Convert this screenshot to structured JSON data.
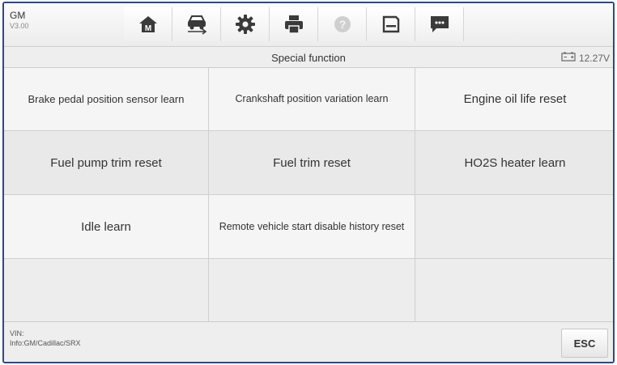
{
  "app": {
    "brand": "GM",
    "version": "V3.00"
  },
  "toolbar": [
    {
      "icon": "home-icon"
    },
    {
      "icon": "vehicle-swap-icon"
    },
    {
      "icon": "settings-gear-icon"
    },
    {
      "icon": "printer-icon"
    },
    {
      "icon": "help-icon"
    },
    {
      "icon": "save-icon"
    },
    {
      "icon": "message-icon"
    }
  ],
  "header": {
    "title": "Special function",
    "voltage": "12.27V"
  },
  "functions": {
    "brake_pedal": "Brake pedal position sensor learn",
    "crankshaft": "Crankshaft position variation learn",
    "engine_oil": "Engine oil life reset",
    "fuel_pump": "Fuel pump trim reset",
    "fuel_trim": "Fuel trim reset",
    "ho2s": "HO2S heater learn",
    "idle": "Idle learn",
    "remote_start": "Remote vehicle start disable history reset"
  },
  "footer": {
    "vin_label": "VIN:",
    "info": "Info:GM/Cadillac/SRX",
    "esc_label": "ESC"
  }
}
